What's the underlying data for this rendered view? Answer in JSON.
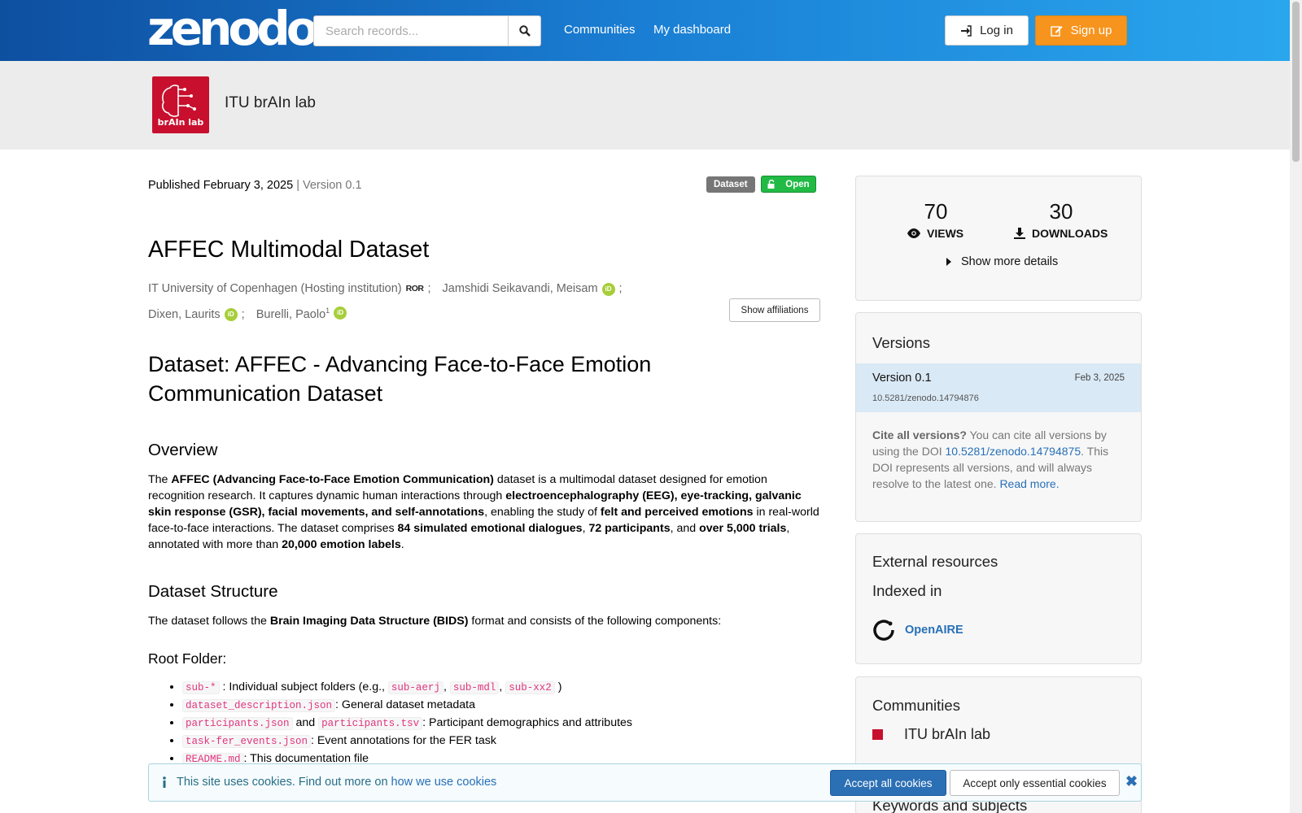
{
  "header": {
    "logo_text": "zenodo",
    "search_placeholder": "Search records...",
    "nav": [
      "Communities",
      "My dashboard"
    ],
    "login_label": "Log in",
    "signup_label": "Sign up"
  },
  "community": {
    "name": "ITU brAIn lab",
    "logo_text": "brAIn lab"
  },
  "record": {
    "published": "Published February 3, 2025",
    "version": "| Version 0.1",
    "resource_type": "Dataset",
    "access": "Open",
    "title": "AFFEC Multimodal Dataset",
    "creators": [
      {
        "name": "IT University of Copenhagen (Hosting institution)",
        "badge": "ROR"
      },
      {
        "name": "Jamshidi Seikavandi, Meisam",
        "badge": "iD"
      },
      {
        "name": "Dixen, Laurits",
        "badge": "iD"
      },
      {
        "name": "Burelli, Paolo",
        "sup": "1",
        "badge": "iD"
      }
    ],
    "show_affiliations": "Show affiliations"
  },
  "description": {
    "h1": "Dataset: AFFEC - Advancing Face-to-Face Emotion Communication Dataset",
    "overview_heading": "Overview",
    "overview": {
      "t1": "The ",
      "b1": "AFFEC (Advancing Face-to-Face Emotion Communication)",
      "t2": " dataset is a multimodal dataset designed for emotion recognition research. It captures dynamic human interactions through ",
      "b2": "electroencephalography (EEG), eye-tracking, galvanic skin response (GSR), facial movements, and self-annotations",
      "t3": ", enabling the study of ",
      "b3": "felt and perceived emotions",
      "t4": " in real-world face-to-face interactions. The dataset comprises ",
      "b4": "84 simulated emotional dialogues",
      "t5": ", ",
      "b5": "72 participants",
      "t6": ", and ",
      "b6": "over 5,000 trials",
      "t7": ", annotated with more than ",
      "b7": "20,000 emotion labels",
      "t8": "."
    },
    "structure_heading": "Dataset Structure",
    "structure": {
      "t1": "The dataset follows the ",
      "b1": "Brain Imaging Data Structure (BIDS)",
      "t2": " format and consists of the following components:"
    },
    "root_heading": "Root Folder:",
    "files": {
      "f1_code": "sub-*",
      "f1_text": " : Individual subject folders (e.g., ",
      "f1_ex1": "sub-aerj",
      "f1_ex2": "sub-mdl",
      "f1_ex3": "sub-xx2",
      "f1_end": " )",
      "f2_code": "dataset_description.json",
      "f2_text": ": General dataset metadata",
      "f3_code": "participants.json",
      "f3_and": " and ",
      "f3_code2": "participants.tsv",
      "f3_text": ": Participant demographics and attributes",
      "f4_code": "task-fer_events.json",
      "f4_text": ": Event annotations for the FER task",
      "f5_code": "README.md",
      "f5_text": ": This documentation file"
    }
  },
  "stats": {
    "views": "70",
    "views_label": "VIEWS",
    "downloads": "30",
    "downloads_label": "DOWNLOADS",
    "more": "Show more details"
  },
  "versions": {
    "heading": "Versions",
    "current": "Version 0.1",
    "date": "Feb 3, 2025",
    "doi": "10.5281/zenodo.14794876",
    "cite_bold": "Cite all versions?",
    "cite_t1": " You can cite all versions by using the DOI ",
    "cite_doi": "10.5281/zenodo.14794875",
    "cite_t2": ". This DOI represents all versions, and will always resolve to the latest one. ",
    "cite_more": "Read more."
  },
  "external": {
    "heading": "External resources",
    "indexed": "Indexed in",
    "openaire": "OpenAIRE"
  },
  "communities": {
    "heading": "Communities",
    "item": "ITU brAIn lab"
  },
  "keywords_heading": "Keywords and subjects",
  "cookie": {
    "text": "This site uses cookies. Find out more on ",
    "link": "how we use cookies",
    "accept_all": "Accept all cookies",
    "essential": "Accept only essential cookies"
  },
  "colors": {
    "brand_orange": "#f7941d",
    "accent_blue": "#2770b8",
    "open_green": "#21ba45"
  }
}
